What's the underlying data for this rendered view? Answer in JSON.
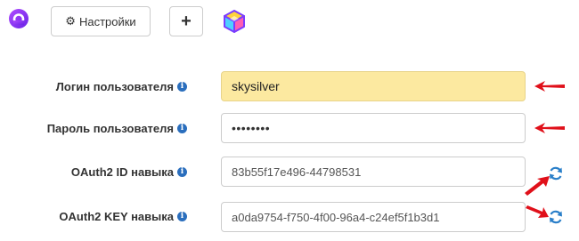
{
  "toolbar": {
    "settings_label": "Настройки",
    "settings_icon": "gear-icon",
    "add_label": "+",
    "logo_icon": "alice-logo-icon",
    "cube_icon": "cube-icon"
  },
  "form": {
    "login": {
      "label": "Логин пользователя",
      "value": "skysilver"
    },
    "password": {
      "label": "Пароль пользователя",
      "value": "••••••••"
    },
    "oauth_id": {
      "label": "OAuth2 ID навыка",
      "value": "83b55f17e496-44798531"
    },
    "oauth_key": {
      "label": "OAuth2 KEY навыка",
      "value": "a0da9754-f750-4f00-96a4-c24ef5f1b3d1"
    }
  },
  "info_icon_glyph": "i",
  "colors": {
    "highlight": "#fce9a0",
    "arrow": "#e0101a",
    "info": "#2a6ebd",
    "refresh": "#2a7fc9",
    "alice_purple": "#8a33ff"
  }
}
